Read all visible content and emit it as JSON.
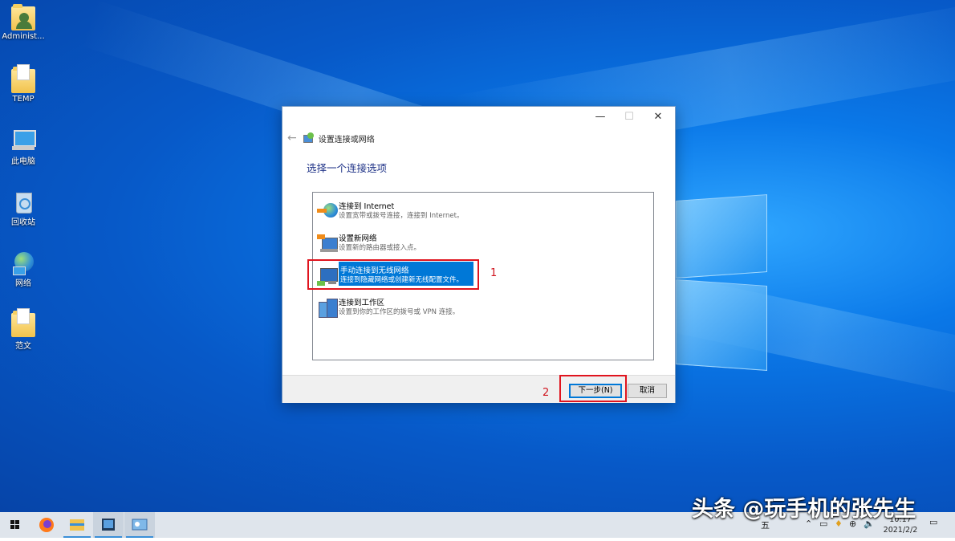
{
  "desktop": {
    "icons": [
      {
        "label": "Administ...",
        "icon": "user-folder-icon"
      },
      {
        "label": "TEMP",
        "icon": "folder-icon"
      },
      {
        "label": "此电脑",
        "icon": "computer-icon"
      },
      {
        "label": "回收站",
        "icon": "recycle-bin-icon"
      },
      {
        "label": "网络",
        "icon": "network-globe-icon"
      },
      {
        "label": "范文",
        "icon": "folder-icon"
      }
    ]
  },
  "dialog": {
    "window_title": "设置连接或网络",
    "heading": "选择一个连接选项",
    "options": [
      {
        "title": "连接到 Internet",
        "desc": "设置宽带或拨号连接，连接到 Internet。",
        "icon": "internet-globe-icon"
      },
      {
        "title": "设置新网络",
        "desc": "设置新的路由器或接入点。",
        "icon": "new-network-icon"
      },
      {
        "title": "手动连接到无线网络",
        "desc": "连接到隐藏网络或创建新无线配置文件。",
        "icon": "wireless-monitor-icon",
        "selected": true
      },
      {
        "title": "连接到工作区",
        "desc": "设置到你的工作区的拨号或 VPN 连接。",
        "icon": "workplace-icon"
      }
    ],
    "buttons": {
      "next": "下一步(N)",
      "cancel": "取消"
    },
    "window_controls": {
      "minimize": "—",
      "maximize": "☐",
      "close": "✕"
    }
  },
  "annotations": {
    "marker1": "1",
    "marker2": "2"
  },
  "taskbar": {
    "clock_time": "10:17",
    "clock_date": "2021/2/2",
    "ime": "五"
  },
  "watermark": "头条 @玩手机的张先生",
  "colors": {
    "accent": "#0078d7",
    "annotation_red": "#e0141e",
    "heading_blue": "#1e3287"
  }
}
